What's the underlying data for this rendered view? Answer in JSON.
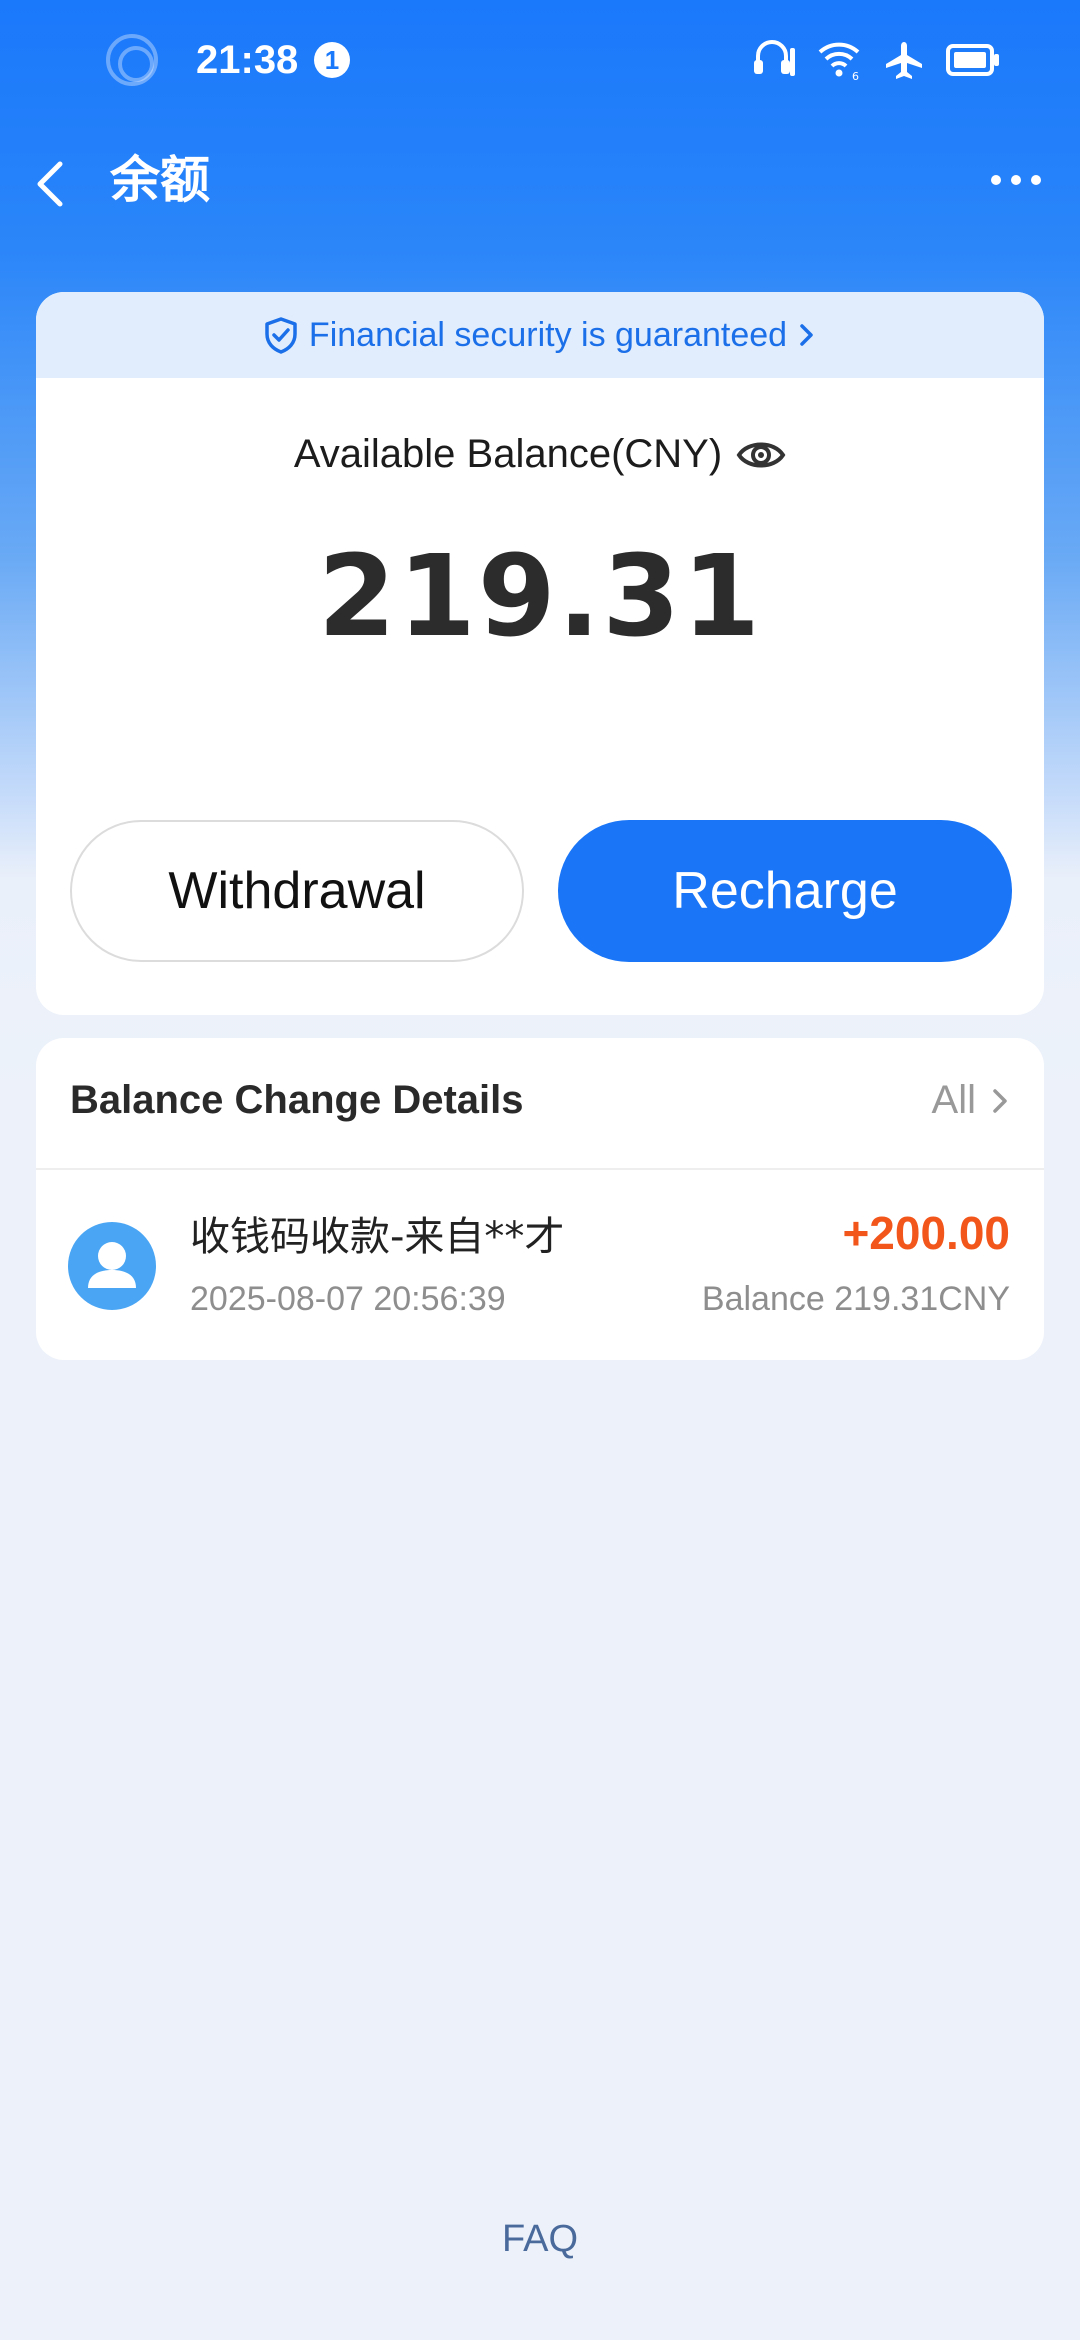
{
  "status_bar": {
    "time": "21:38",
    "notification_count": "1"
  },
  "header": {
    "title": "余额"
  },
  "security_banner": {
    "text": "Financial security is guaranteed"
  },
  "balance": {
    "label": "Available Balance(CNY)",
    "amount": "219.31"
  },
  "actions": {
    "withdraw_label": "Withdrawal",
    "recharge_label": "Recharge"
  },
  "details": {
    "title": "Balance Change Details",
    "filter_label": "All",
    "transactions": [
      {
        "title": "收钱码收款-来自**才",
        "time": "2025-08-07 20:56:39",
        "amount": "+200.00",
        "balance": "Balance 219.31CNY"
      }
    ]
  },
  "footer": {
    "faq_label": "FAQ"
  },
  "colors": {
    "primary": "#1a76f7",
    "amount_positive": "#f3561b",
    "banner_bg": "#e1edfc"
  }
}
